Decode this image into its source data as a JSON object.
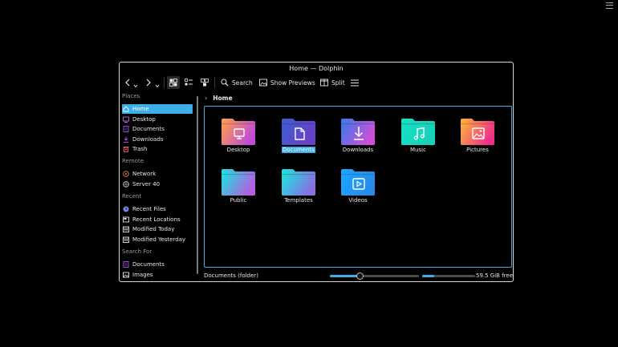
{
  "window": {
    "title": "Home — Dolphin"
  },
  "toolbar": {
    "back_icon": "back-arrow-icon",
    "forward_icon": "forward-arrow-icon",
    "search_label": "Search",
    "previews_label": "Show Previews",
    "split_label": "Split"
  },
  "sidebar": {
    "places_header": "Places",
    "places": [
      {
        "label": "Home",
        "icon": "home-icon",
        "color": "#ffffff"
      },
      {
        "label": "Desktop",
        "icon": "desktop-icon",
        "color": "#d65fe0"
      },
      {
        "label": "Documents",
        "icon": "documents-icon",
        "color": "#a855f7"
      },
      {
        "label": "Downloads",
        "icon": "downloads-icon",
        "color": "#a855f7"
      },
      {
        "label": "Trash",
        "icon": "trash-icon",
        "color": "#ff5577"
      }
    ],
    "remote_header": "Remote",
    "remote": [
      {
        "label": "Network",
        "icon": "network-icon",
        "color": "#ff7a50"
      },
      {
        "label": "Server 40",
        "icon": "server-icon",
        "color": "#cccccc"
      }
    ],
    "recent_header": "Recent",
    "recent": [
      {
        "label": "Recent Files",
        "icon": "recent-files-icon",
        "color": "#6d8ce6"
      },
      {
        "label": "Recent Locations",
        "icon": "recent-locations-icon",
        "color": "#e6e6e6"
      },
      {
        "label": "Modified Today",
        "icon": "calendar-icon",
        "color": "#e6e6e6"
      },
      {
        "label": "Modified Yesterday",
        "icon": "calendar-icon",
        "color": "#e6e6e6"
      }
    ],
    "search_header": "Search For",
    "search": [
      {
        "label": "Documents",
        "icon": "documents-icon",
        "color": "#a855f7"
      },
      {
        "label": "Images",
        "icon": "images-icon",
        "color": "#e6e6e6"
      }
    ]
  },
  "breadcrumb": {
    "current": "Home"
  },
  "files": [
    {
      "name": "Desktop",
      "icon": "desktop-folder-icon",
      "c1": "#ff9e4a",
      "c2": "#c04bd8",
      "selected": false
    },
    {
      "name": "Documents",
      "icon": "documents-folder-icon",
      "c1": "#3d5fd0",
      "c2": "#6a3fc8",
      "selected": true
    },
    {
      "name": "Downloads",
      "icon": "downloads-folder-icon",
      "c1": "#3a7ae8",
      "c2": "#d04fd8",
      "selected": false
    },
    {
      "name": "Music",
      "icon": "music-folder-icon",
      "c1": "#18e0c8",
      "c2": "#19d0b8",
      "selected": false
    },
    {
      "name": "Pictures",
      "icon": "pictures-folder-icon",
      "c1": "#ffb43a",
      "c2": "#f02f8a",
      "selected": false
    },
    {
      "name": "Public",
      "icon": "public-folder-icon",
      "c1": "#19e6e0",
      "c2": "#b55ee0",
      "selected": false
    },
    {
      "name": "Templates",
      "icon": "templates-folder-icon",
      "c1": "#19e6e0",
      "c2": "#8a6fe0",
      "selected": false
    },
    {
      "name": "Videos",
      "icon": "videos-folder-icon",
      "c1": "#1aa7ff",
      "c2": "#2a8ae8",
      "selected": false
    }
  ],
  "status": {
    "text": "Documents (folder)",
    "zoom_fraction": 0.33,
    "space_used_fraction": 0.23,
    "free_text": "59.5 GiB free"
  },
  "colors": {
    "accent": "#3daee9",
    "background": "#000000",
    "text": "#e6e6e6"
  }
}
